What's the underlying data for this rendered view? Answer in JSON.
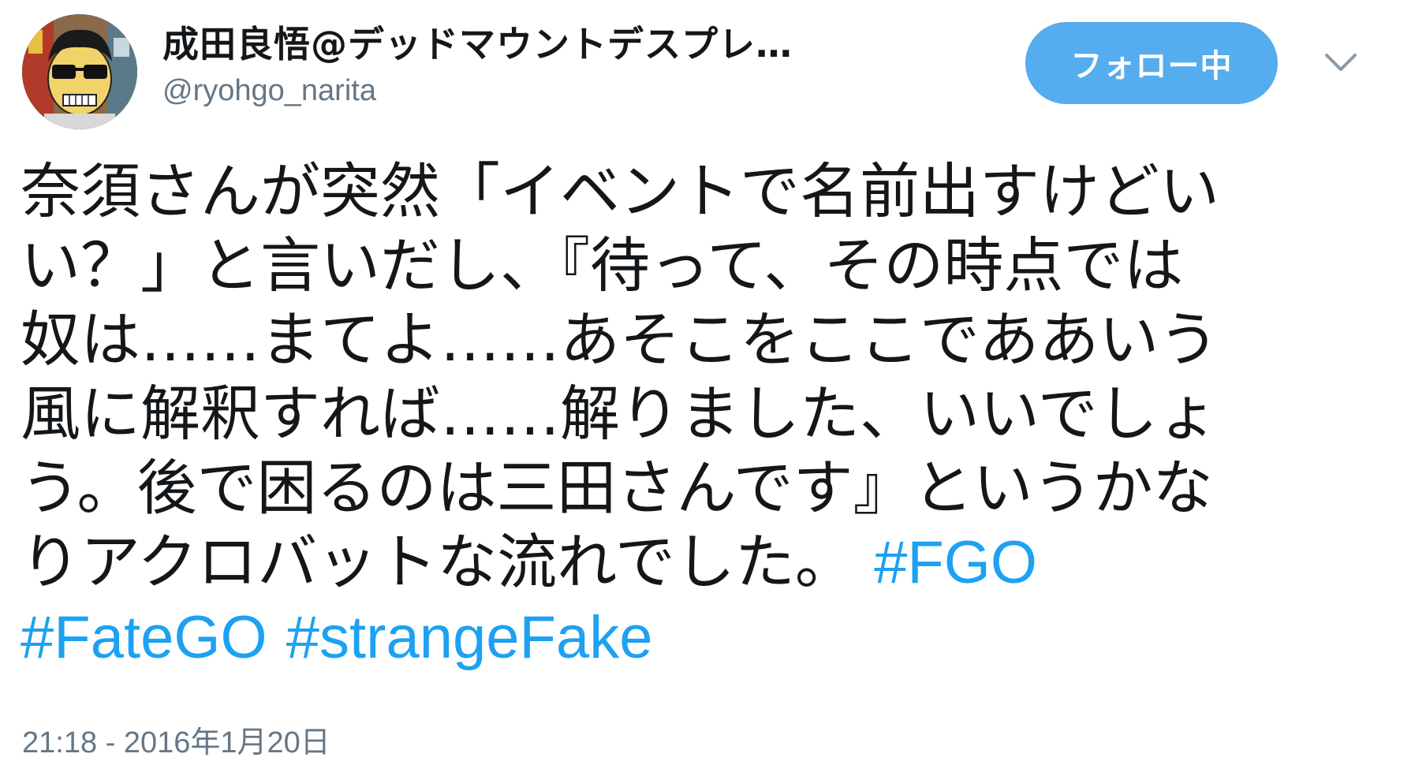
{
  "author": {
    "display_name": "成田良悟@デッドマウントデスプレ…",
    "handle": "@ryohgo_narita",
    "avatar_icon": "user-avatar"
  },
  "follow_button": {
    "label": "フォロー中",
    "color": "#55acee"
  },
  "menu": {
    "icon": "chevron-down-icon"
  },
  "tweet": {
    "lines": [
      "奈須さんが突然「イベントで名前出すけどい",
      "い？」と言いだし、『待って、その時点では",
      "奴は……まてよ……あそこをここでああいう",
      "風に解釈すれば……解りました、いいでしょ",
      "う。後で困るのは三田さんです』というかな",
      "りアクロバットな流れでした。 "
    ],
    "hashtags": [
      "#FGO",
      "#FateGO",
      "#strangeFake"
    ],
    "hashtag_color": "#1da1f2",
    "timestamp": "21:18 - 2016年1月20日"
  }
}
